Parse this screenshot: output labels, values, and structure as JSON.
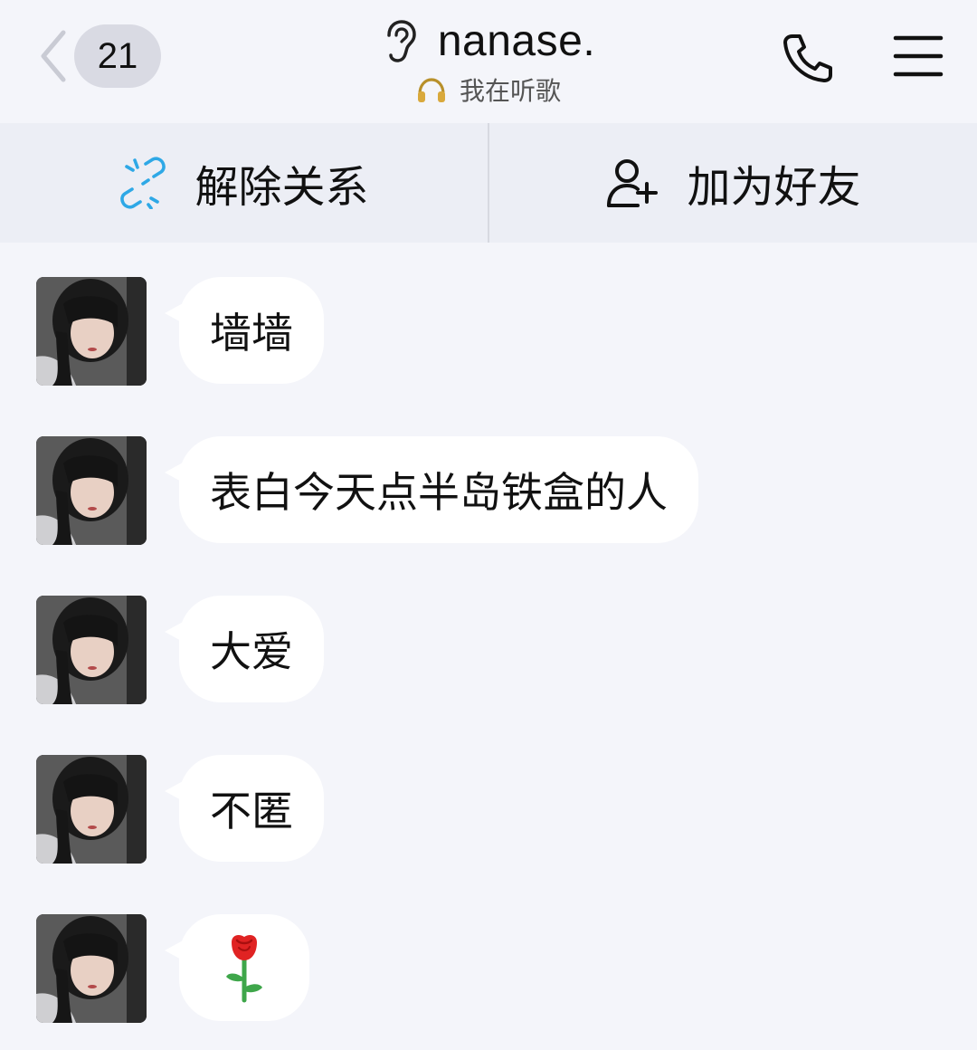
{
  "header": {
    "unread_count": "21",
    "title": "nanase.",
    "status": "我在听歌"
  },
  "actions": {
    "remove_relation": "解除关系",
    "add_friend": "加为好友"
  },
  "messages": [
    {
      "text": "墙墙"
    },
    {
      "text": "表白今天点半岛铁盒的人"
    },
    {
      "text": "大爱"
    },
    {
      "text": "不匿"
    },
    {
      "emoji": "rose-icon"
    }
  ],
  "colors": {
    "background": "#f4f5fa",
    "action_bar": "#eceef5",
    "bubble": "#ffffff",
    "badge": "#d9dae3",
    "link_icon": "#2ea8e6"
  }
}
